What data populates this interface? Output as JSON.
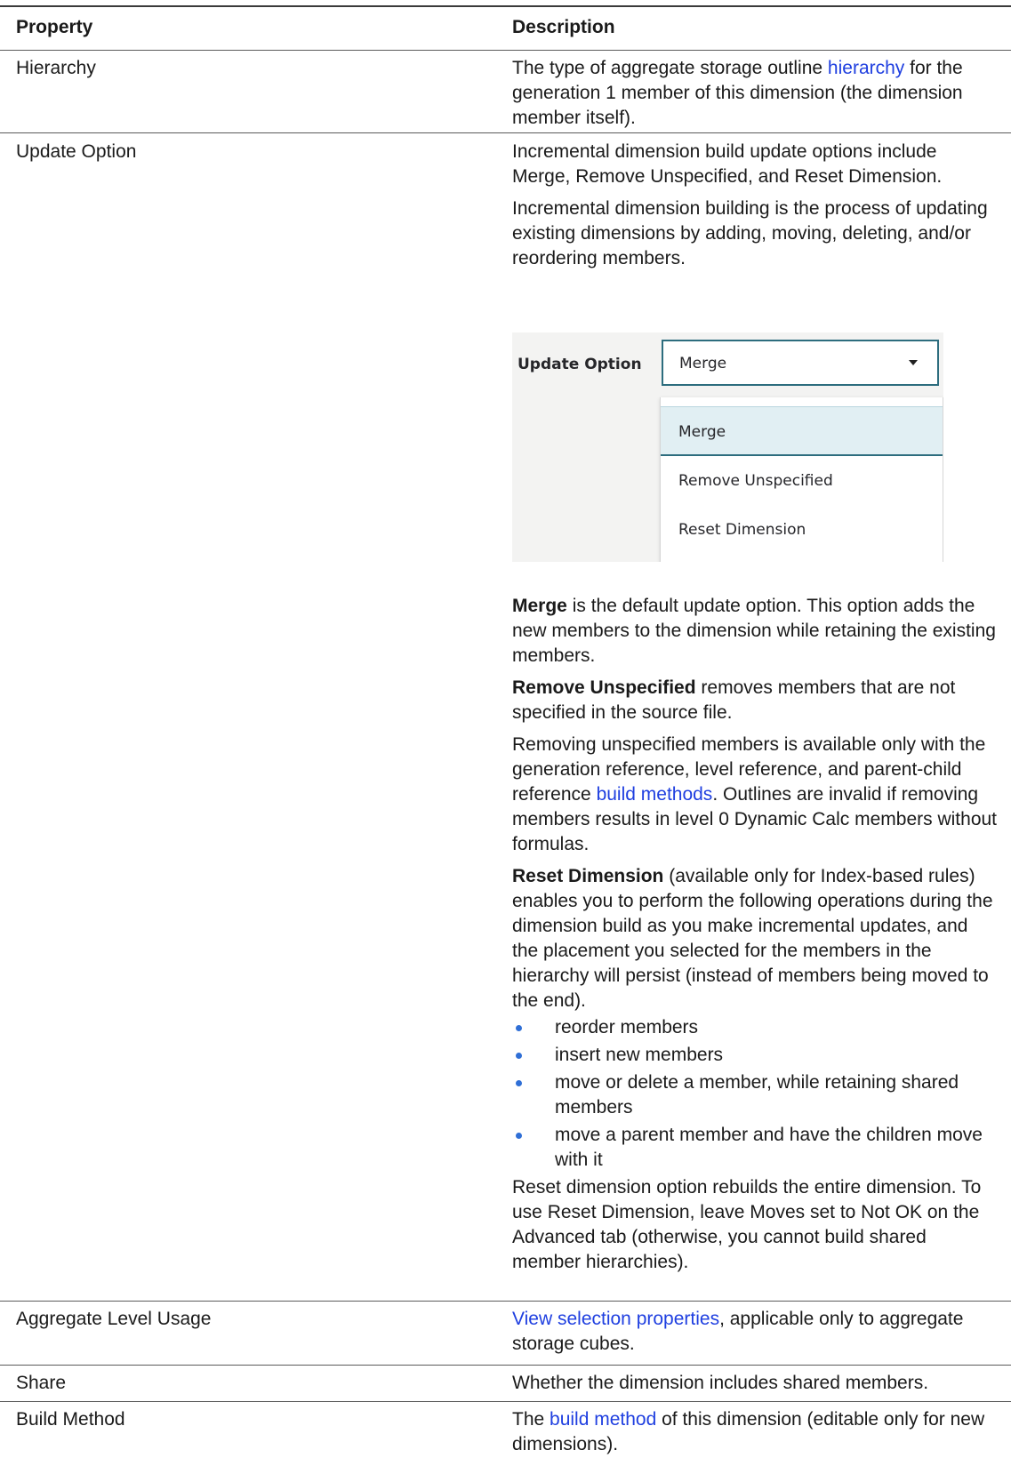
{
  "header": {
    "property": "Property",
    "description": "Description"
  },
  "rows": {
    "hierarchy": {
      "property": "Hierarchy",
      "d1": "The type of aggregate storage outline ",
      "d1_link": "hierarchy",
      "d1_end": " for the generation 1 member of this dimension (the dimension member itself)."
    },
    "update_option": {
      "property": "Update Option",
      "p1": "Incremental dimension build update options include Merge, Remove Unspecified, and Reset Dimension.",
      "p2": "Incremental dimension building is the process of updating existing dimensions by adding, moving, deleting, and/or reordering members.",
      "screenshot": {
        "label": "Update Option",
        "selected_value": "Merge",
        "options": [
          "Merge",
          "Remove Unspecified",
          "Reset Dimension"
        ]
      },
      "merge_bold": "Merge",
      "merge_text": " is the default update option. This option adds the new members to the dimension while retaining the existing members.",
      "remove_bold": "Remove Unspecified",
      "remove_text": " removes members that are not specified in the source file.",
      "removing_text": "Removing unspecified members is available only with the generation reference, level reference, and parent-child reference ",
      "removing_link": "build methods",
      "removing_end": ". Outlines are invalid if removing members results in level 0 Dynamic Calc members without formulas.",
      "reset_bold": "Reset Dimension",
      "reset_text": " (available only for Index-based rules) enables you to perform the following operations during the dimension build as you make incremental updates, and the placement you selected for the members in the hierarchy will persist (instead of members being moved to the end).",
      "bullets": [
        "reorder members",
        "insert new members",
        "move or delete a member, while retaining shared members",
        "move a parent member and have the children move with it"
      ],
      "reset_note": "Reset dimension option rebuilds the entire dimension. To use Reset Dimension, leave Moves set to Not OK on the Advanced tab (otherwise, you cannot build shared member hierarchies)."
    },
    "aggregate": {
      "property": "Aggregate Level Usage",
      "link": "View selection properties",
      "text": ", applicable only to aggregate storage cubes."
    },
    "share": {
      "property": "Share",
      "text": "Whether the dimension includes shared members."
    },
    "build_method": {
      "property": "Build Method",
      "d1": "The ",
      "link": "build method",
      "d1_end": " of this dimension (editable only for new dimensions)."
    }
  },
  "colors": {
    "link": "#1f3fe0",
    "bullet": "#2f6fd6",
    "select_border": "#2d6d7e"
  }
}
